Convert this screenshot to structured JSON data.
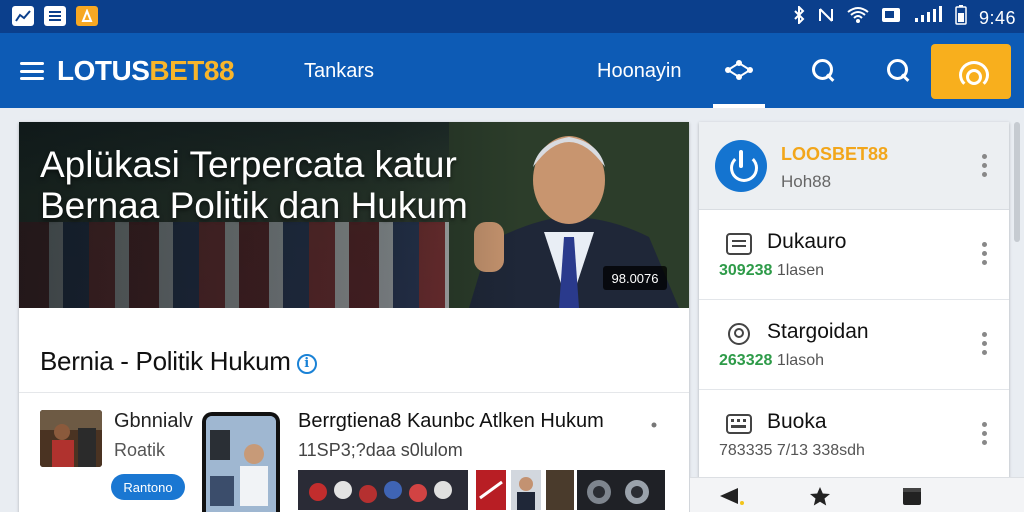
{
  "status_bar": {
    "left_icons": [
      "chart-icon",
      "news-icon",
      "app-icon"
    ],
    "right_icons": [
      "bluetooth-icon",
      "nfc-icon",
      "wifi-icon",
      "cast-icon",
      "signal-icon",
      "battery-icon"
    ],
    "time": "9:46"
  },
  "app_bar": {
    "logo_part1": "LOTUS",
    "logo_part2": "BET88",
    "nav_links": [
      "Tankars",
      "Hoonayin"
    ],
    "icons": [
      "share-icon",
      "search-icon",
      "search-icon",
      "headset-icon"
    ]
  },
  "hero": {
    "title": "Aplükasi Terpercata katur Bernaa Politik dan Hukum",
    "badge": "98.0076"
  },
  "section": {
    "title": "Bernia - Politik Hukum"
  },
  "item_a": {
    "title": "Gbnnialv",
    "subtitle": "Roatik",
    "button_label": "Rantono"
  },
  "item_b": {
    "title": "Berrgtiena8 Kaunbc Atlken Hukum",
    "subtitle": "11SP3;?daa s0lulom"
  },
  "panel": {
    "header_title": "LOOSBET88",
    "header_sub": "Hoh88",
    "rows": [
      {
        "title": "Dukauro",
        "num": "309238",
        "sub": " 1lasen",
        "icon": "document-icon",
        "num_green": true
      },
      {
        "title": "Stargoidan",
        "num": "263328",
        "sub": " 1lasoh",
        "icon": "location-icon",
        "num_green": true
      },
      {
        "title": "Buoka",
        "num": "783335",
        "sub": " 7/13 338sdh",
        "icon": "keyboard-icon",
        "num_green": false
      }
    ]
  },
  "bottom_nav": {
    "icons": [
      "back-icon",
      "star-icon",
      "square-icon"
    ]
  },
  "colors": {
    "status_bar": "#0b3f8c",
    "app_bar": "#0d5bb5",
    "accent_orange": "#f8af1d",
    "logo_gold": "#f7b52b",
    "link_blue": "#1a77d2",
    "green": "#2e9b49"
  }
}
